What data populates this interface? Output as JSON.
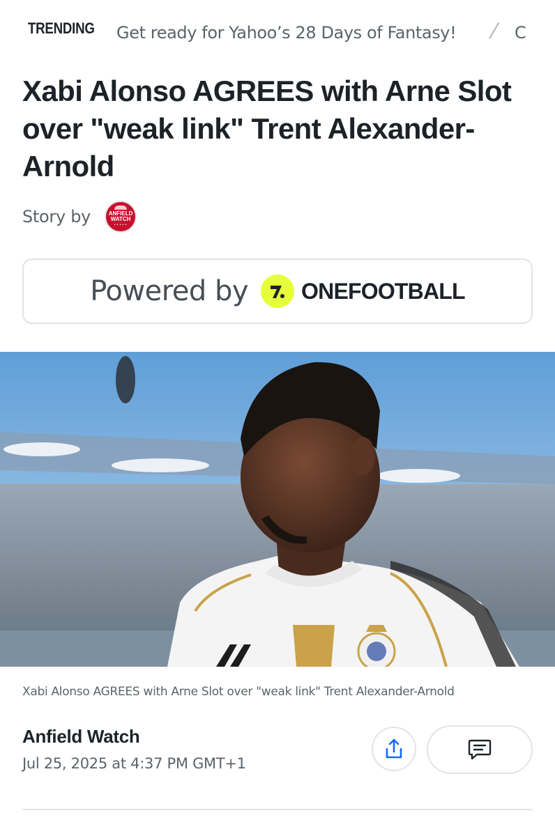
{
  "trending": {
    "label": "TRENDING",
    "items": [
      "Get ready for Yahoo’s 28 Days of Fantasy!",
      "C"
    ],
    "separator": "/"
  },
  "article": {
    "headline": "Xabi Alonso AGREES with Arne Slot over \"weak link\" Trent Alexander-Arnold",
    "story_by_label": "Story by",
    "publisher_logo": {
      "icon": "anfield-watch-logo",
      "lines": [
        "ANFIELD",
        "WATCH"
      ]
    },
    "caption": "Xabi Alonso AGREES with Arne Slot over \"weak link\" Trent Alexander-Arnold",
    "author": "Anfield Watch",
    "date": "Jul 25, 2025 at 4:37 PM GMT+1"
  },
  "powered": {
    "label": "Powered by",
    "brand": "ONEFOOTBALL",
    "brand_color": "#e5ff3b"
  },
  "actions": {
    "share_icon": "share-icon",
    "comment_icon": "comment-icon",
    "accent_color": "#0f69ff"
  }
}
